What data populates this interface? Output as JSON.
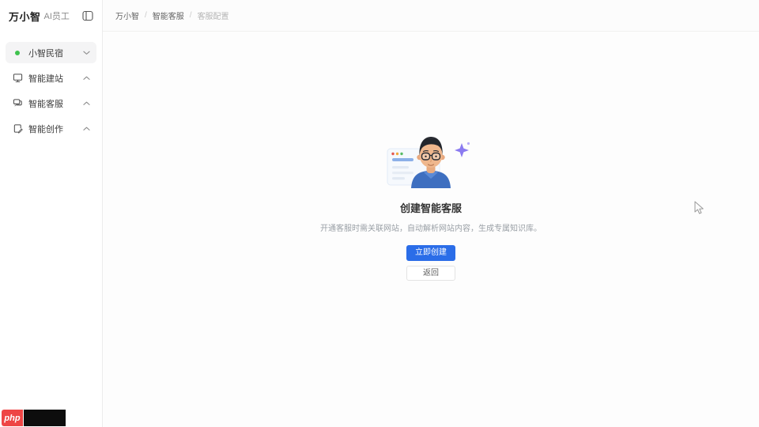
{
  "sidebar": {
    "logo": {
      "brand": "万小智",
      "suffix": "AI员工"
    },
    "items": [
      {
        "label": "小智民宿",
        "icon": "status-dot",
        "chevron": "down",
        "selected": true
      },
      {
        "label": "智能建站",
        "icon": "monitor",
        "chevron": "up",
        "selected": false
      },
      {
        "label": "智能客服",
        "icon": "chat",
        "chevron": "up",
        "selected": false
      },
      {
        "label": "智能创作",
        "icon": "compose",
        "chevron": "up",
        "selected": false
      }
    ]
  },
  "breadcrumb": {
    "separator": "/",
    "items": [
      "万小智",
      "智能客服",
      "客服配置"
    ]
  },
  "empty_state": {
    "title": "创建智能客服",
    "description": "开通客服时需关联网站，自动解析网站内容，生成专属知识库。",
    "primary_button": "立即创建",
    "secondary_button": "返回"
  },
  "watermark": {
    "badge": "php"
  },
  "colors": {
    "primary_blue": "#2b6de8",
    "status_green": "#3fc24e",
    "sparkle_purple": "#8b7bf0",
    "watermark_red": "#ee4545"
  }
}
